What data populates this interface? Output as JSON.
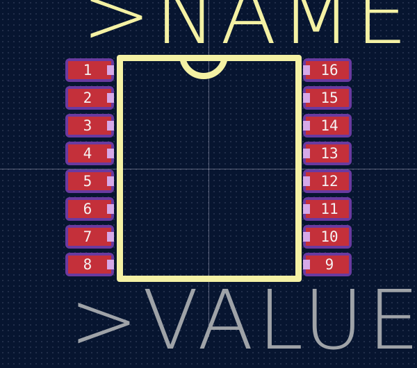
{
  "footprint": {
    "reference_label": ">NAME",
    "value_label": ">VALUE",
    "pads_left": [
      "1",
      "2",
      "3",
      "4",
      "5",
      "6",
      "7",
      "8"
    ],
    "pads_right": [
      "16",
      "15",
      "14",
      "13",
      "12",
      "11",
      "10",
      "9"
    ]
  },
  "colors": {
    "background": "#071530",
    "silkscreen": "#f4f1a4",
    "value_text": "#9fa3a8",
    "pad_copper": "#c4303a",
    "pad_mask": "#6a3aa0",
    "pin_lead": "#d6a9e8"
  }
}
